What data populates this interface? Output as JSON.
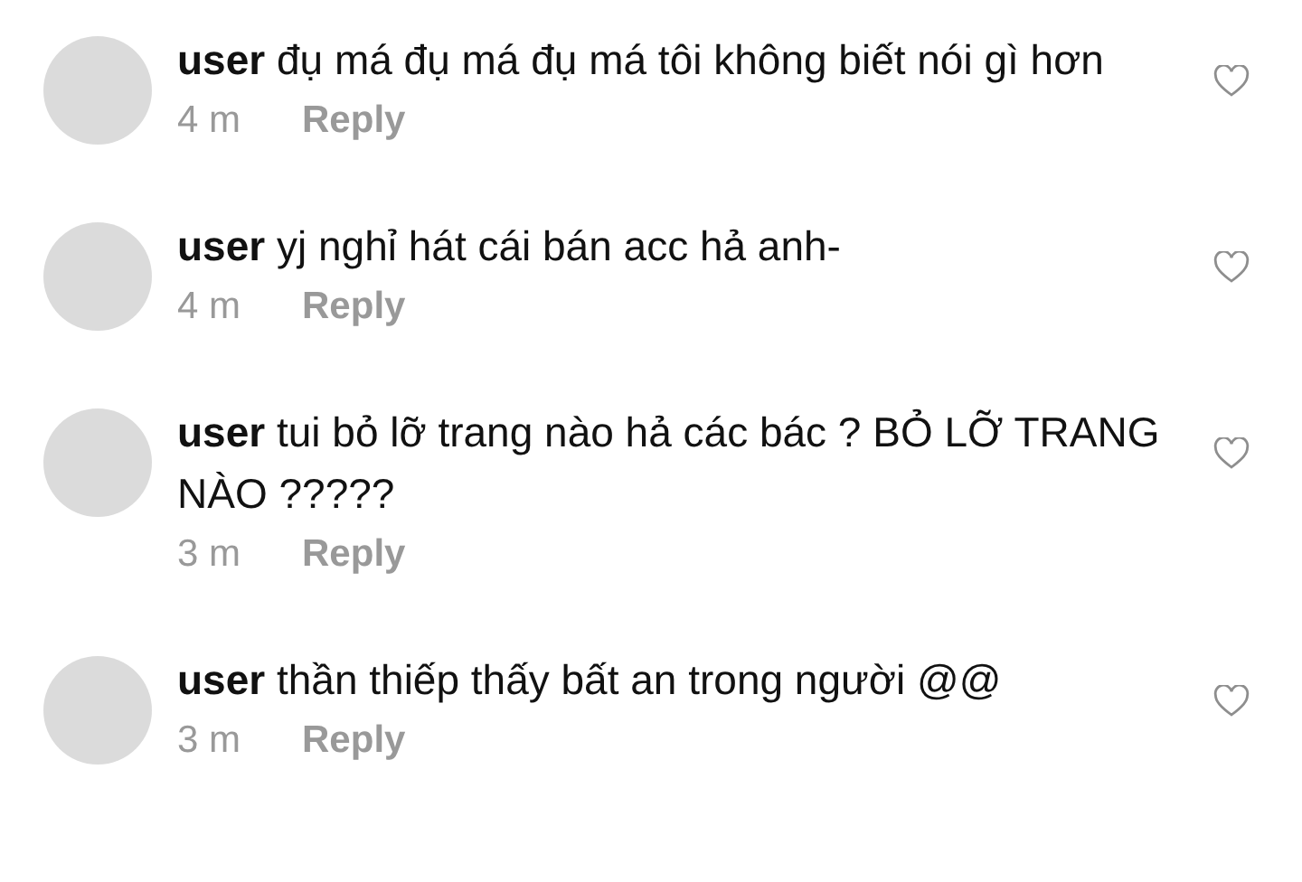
{
  "comments": [
    {
      "text": "**user** đụ má đụ má đụ má tôi không biết nói gì hơn",
      "time": "4 m",
      "reply": "Reply",
      "liked": false
    },
    {
      "text": "**user** yj nghỉ hát cái bán acc hả anh-",
      "time": "4 m",
      "reply": "Reply",
      "liked": false
    },
    {
      "text": "**user** tui bỏ lỡ trang nào hả các bác ? BỎ LỠ TRANG NÀO ?????",
      "time": "3 m",
      "reply": "Reply",
      "liked": false
    },
    {
      "text": "**user** thần thiếp thấy bất an trong người @@",
      "time": "3 m",
      "reply": "Reply",
      "liked": false
    }
  ]
}
